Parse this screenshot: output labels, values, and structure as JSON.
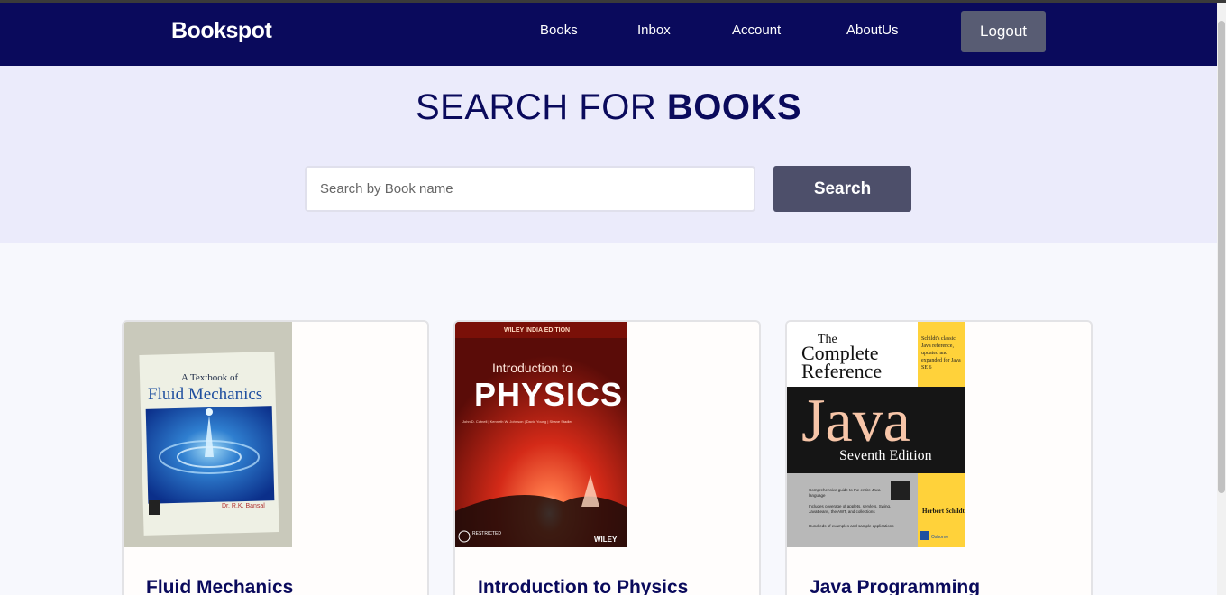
{
  "brand": "Bookspot",
  "nav": {
    "books": "Books",
    "inbox": "Inbox",
    "account": "Account",
    "aboutus": "AboutUs",
    "logout": "Logout"
  },
  "hero": {
    "title_light": "SEARCH FOR ",
    "title_bold": "BOOKS",
    "search_placeholder": "Search by Book name",
    "search_button": "Search"
  },
  "books": [
    {
      "title": "Fluid Mechanics",
      "cover": {
        "line1": "A Textbook of",
        "line2": "Fluid Mechanics",
        "author": "Dr. R.K. Bansal"
      }
    },
    {
      "title": "Introduction to Physics",
      "cover": {
        "edition": "WILEY INDIA EDITION",
        "line1": "Introduction to",
        "line2": "PHYSICS",
        "authors": "John D. Cutnell | Kenneth W. Johnson | David Young | Shane Stadler",
        "publisher": "WILEY",
        "restricted": "RESTRICTED"
      }
    },
    {
      "title": "Java Programming",
      "cover": {
        "the": "The",
        "complete": "Complete",
        "reference": "Reference",
        "side_note": "Schildt's classic Java reference, updated and expanded for Java SE 6",
        "java": "Java",
        "edition": "Seventh Edition",
        "author": "Herbert Schildt",
        "bullet1": "Comprehensive guide to the entire Java language",
        "bullet2": "Includes coverage of applets, servlets, Swing, JavaBeans, the AWT, and collections",
        "bullet3": "Hundreds of examples and sample applications",
        "publisher": "Osborne"
      }
    }
  ],
  "colors": {
    "navbar": "#0a0a5c",
    "hero_bg": "#ebebfb",
    "button": "#4d4f6a",
    "title_text": "#0a0a5c"
  }
}
